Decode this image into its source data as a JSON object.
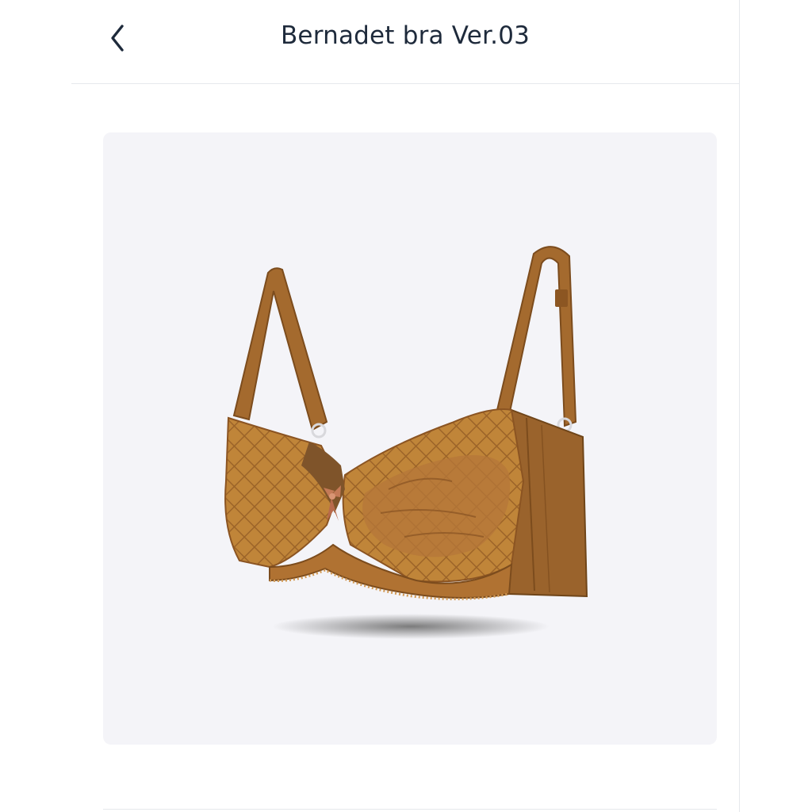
{
  "header": {
    "title": "Bernadet bra Ver.03",
    "back_icon": "chevron-left-icon"
  },
  "product": {
    "image_subject": "bra",
    "colors": {
      "fabric": "#b97a35",
      "fabric_dark": "#8f5a25",
      "lace": "#c98a43",
      "bow": "#c47a57",
      "background": "#f4f4f8"
    }
  },
  "colors": {
    "text": "#1e2a3b",
    "divider": "#e6e8ec",
    "page": "#ffffff"
  }
}
